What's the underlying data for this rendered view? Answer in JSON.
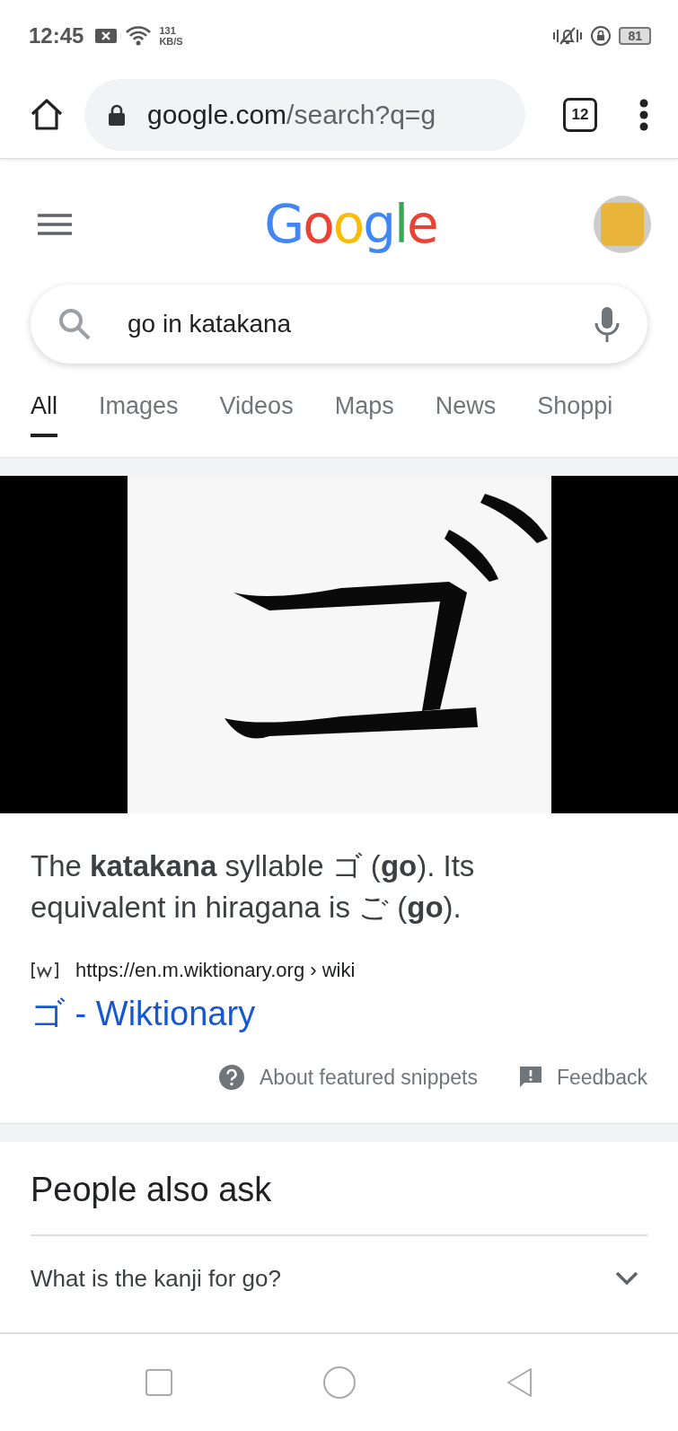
{
  "status_bar": {
    "time": "12:45",
    "speed_value": "131",
    "speed_unit": "KB/S",
    "battery": "81"
  },
  "browser": {
    "url_host": "google.com",
    "url_path": "/search?q=g",
    "tab_count": "12"
  },
  "header": {
    "logo": "Google"
  },
  "search": {
    "value": "go in katakana"
  },
  "tabs": [
    {
      "label": "All",
      "selected": true
    },
    {
      "label": "Images",
      "selected": false
    },
    {
      "label": "Videos",
      "selected": false
    },
    {
      "label": "Maps",
      "selected": false
    },
    {
      "label": "News",
      "selected": false
    },
    {
      "label": "Shoppi",
      "selected": false
    }
  ],
  "featured_snippet": {
    "text": "The **katakana** syllable ゴ (**go**). Its equivalent in hiragana is ご (**go**).",
    "source_url": "https://en.m.wiktionary.org › wiki",
    "title": "ゴ - Wiktionary",
    "about_link": "About featured snippets",
    "feedback_link": "Feedback"
  },
  "people_also_ask": {
    "heading": "People also ask",
    "questions": [
      {
        "text": "What is the kanji for go?",
        "expanded": false
      }
    ]
  }
}
